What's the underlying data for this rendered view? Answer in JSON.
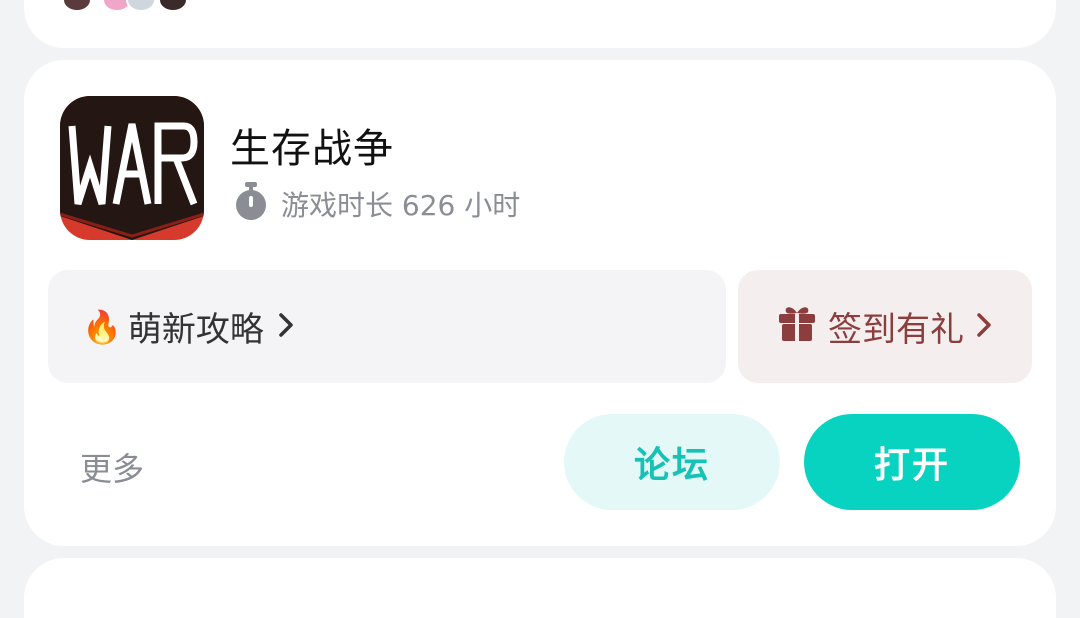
{
  "app": {
    "title": "生存战争",
    "playtime": "游戏时长 626 小时",
    "icon_name": "war-game-logo-icon",
    "icon_text": "WAR"
  },
  "actions": {
    "guide_label": "萌新攻略",
    "guide_emoji": "🔥",
    "gift_label": "签到有礼",
    "more_label": "更多",
    "forum_label": "论坛",
    "open_label": "打开"
  },
  "colors": {
    "accent": "#08d2c0",
    "forum_bg": "#e3f8f7",
    "gift_text": "#8c3d3d",
    "gift_bg": "#f5eeee",
    "icon_red": "#d63a2c"
  }
}
